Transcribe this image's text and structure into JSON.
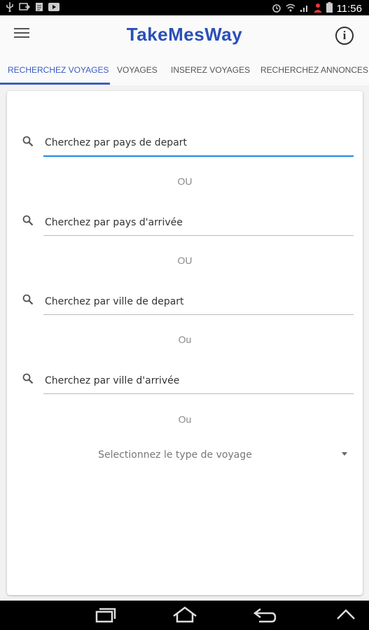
{
  "status_bar": {
    "time": "11:56",
    "icons": [
      "usb-icon",
      "screen-mirror-icon",
      "file-icon",
      "video-icon",
      "alarm-icon",
      "wifi-icon",
      "signal-icon",
      "account-icon",
      "battery-icon"
    ]
  },
  "app_bar": {
    "title": "TakeMesWay",
    "info_label": "i"
  },
  "tabs": [
    {
      "label": "RECHERCHEZ VOYAGES",
      "active": true
    },
    {
      "label": "VOYAGES",
      "active": false
    },
    {
      "label": "INSEREZ VOYAGES",
      "active": false
    },
    {
      "label": "RECHERCHEZ ANNONCES",
      "active": false
    }
  ],
  "search": {
    "departure_country": {
      "placeholder": "Cherchez par pays de depart"
    },
    "arrival_country": {
      "placeholder": "Cherchez par pays d'arrivée"
    },
    "departure_city": {
      "placeholder": "Cherchez par ville de depart"
    },
    "arrival_city": {
      "placeholder": "Cherchez par ville d'arrivée"
    }
  },
  "separators": [
    "OU",
    "OU",
    "Ou",
    "Ou"
  ],
  "trip_type_select": {
    "selected": "Selectionnez le type de voyage"
  },
  "nav_bar": {
    "buttons": [
      "recents-icon",
      "home-icon",
      "back-icon",
      "up-icon"
    ]
  },
  "colors": {
    "accent": "#3b5cc4",
    "focus_underline": "#1e88e5",
    "title": "#2a4fb8"
  }
}
